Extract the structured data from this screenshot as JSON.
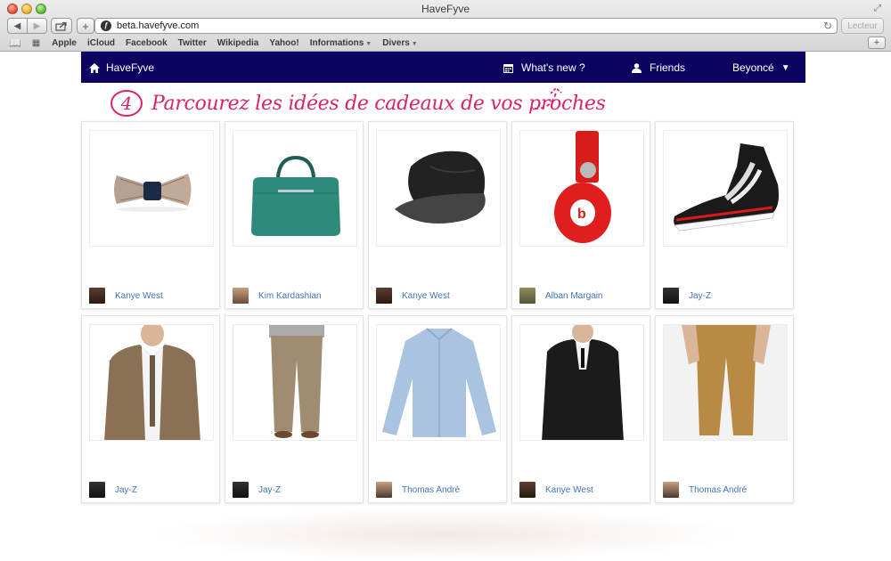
{
  "window": {
    "title": "HaveFyve"
  },
  "browser": {
    "url": "beta.havefyve.com",
    "reader_label": "Lecteur",
    "bookmarks": [
      "Apple",
      "iCloud",
      "Facebook",
      "Twitter",
      "Wikipedia",
      "Yahoo!",
      "Informations",
      "Divers"
    ]
  },
  "site_nav": {
    "home_label": "HaveFyve",
    "whats_new_label": "What's new ?",
    "friends_label": "Friends",
    "user_label": "Beyoncé"
  },
  "headline": {
    "step": "4",
    "text": "Parcourez les idées de cadeaux de vos proches"
  },
  "colors": {
    "nav_bg": "#0d0360",
    "accent": "#d8246c",
    "link": "#3e73b9"
  },
  "items": [
    {
      "product": "bow-tie",
      "owner": "Kanye West"
    },
    {
      "product": "green-bag",
      "owner": "Kim Kardashian"
    },
    {
      "product": "black-cap",
      "owner": "Kanye West"
    },
    {
      "product": "red-headphones",
      "owner": "Alban Margain"
    },
    {
      "product": "sneaker",
      "owner": "Jay-Z"
    },
    {
      "product": "brown-suit",
      "owner": "Jay-Z"
    },
    {
      "product": "khaki-trousers",
      "owner": "Jay-Z"
    },
    {
      "product": "denim-shirt",
      "owner": "Thomas André"
    },
    {
      "product": "black-coat",
      "owner": "Kanye West"
    },
    {
      "product": "tan-chinos",
      "owner": "Thomas André"
    }
  ]
}
